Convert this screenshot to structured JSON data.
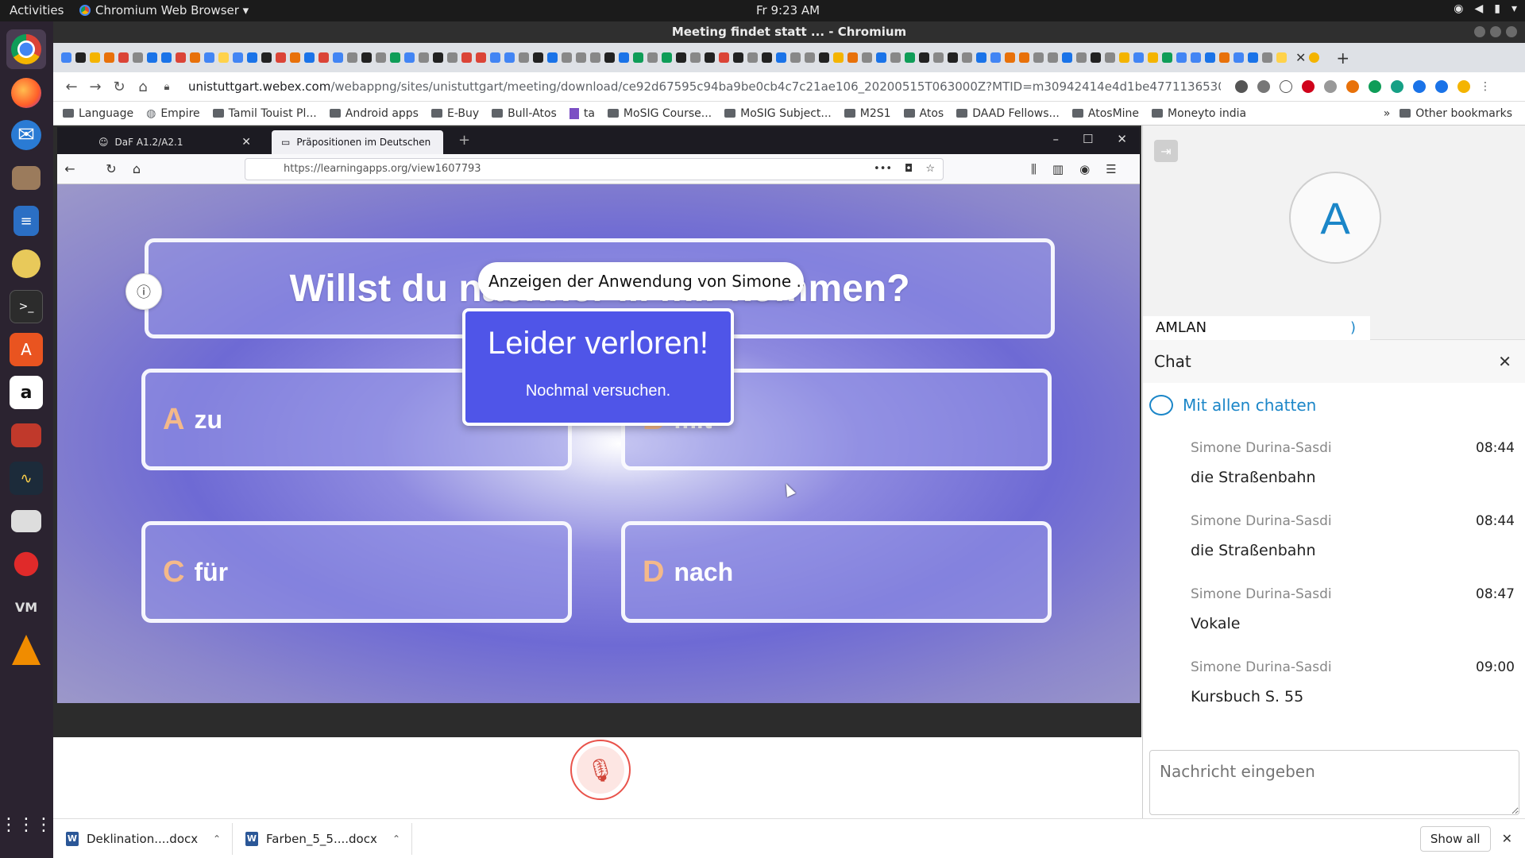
{
  "topbar": {
    "activities": "Activities",
    "app_menu": "Chromium Web Browser ▾",
    "clock": "Fr  9:23 AM"
  },
  "dock": {
    "items": [
      "chromium-icon",
      "firefox-icon",
      "thunderbird-icon",
      "files-icon",
      "writer-icon",
      "rhythmbox-icon",
      "terminal-icon",
      "software-icon",
      "amazon-icon",
      "presentation-icon",
      "monitor-icon",
      "camera-icon",
      "cherry-icon",
      "vm-icon",
      "vlc-icon",
      "apps-grid-icon"
    ]
  },
  "chromium": {
    "window_title": "Meeting findet statt ... - Chromium",
    "url_host": "unistuttgart.webex.com",
    "url_path": "/webappng/sites/unistuttgart/meeting/download/ce92d67595c94ba9be0cb4c7c21ae106_20200515T063000Z?MTID=m30942414e4d1be477113653036162165&launchApp...",
    "bookmarks": [
      "Language",
      "Empire",
      "Tamil Touist Pl...",
      "Android apps",
      "E-Buy",
      "Bull-Atos",
      "ta",
      "MoSIG Course...",
      "MoSIG Subject...",
      "M2S1",
      "Atos",
      "DAAD Fellows...",
      "AtosMine",
      "Moneyto india"
    ],
    "bookmarks_more": "»",
    "other_bookmarks": "Other bookmarks"
  },
  "shared_firefox": {
    "tab1_title": "DaF A1.2/A2.1",
    "tab2_title": "Präpositionen im Deutschen",
    "url": "https://learningapps.org/view1607793",
    "share_banner": "Anzeigen der Anwendung von Simone ..."
  },
  "game": {
    "question": "Willst du nachher ... mir kommen?",
    "answers": [
      {
        "letter": "A",
        "word": "zu"
      },
      {
        "letter": "B",
        "word": "mit"
      },
      {
        "letter": "C",
        "word": "für"
      },
      {
        "letter": "D",
        "word": "nach"
      }
    ],
    "popup_title": "Leider verloren!",
    "popup_subtitle": "Nochmal versuchen."
  },
  "participant": {
    "initial": "A",
    "name": "AMLAN"
  },
  "chat": {
    "title": "Chat",
    "target": "Mit allen chatten",
    "messages": [
      {
        "sender": "Simone Durina-Sasdi",
        "time": "08:44",
        "text": "die Straßenbahn"
      },
      {
        "sender": "Simone Durina-Sasdi",
        "time": "08:44",
        "text": "die Straßenbahn"
      },
      {
        "sender": "Simone Durina-Sasdi",
        "time": "08:47",
        "text": "Vokale"
      },
      {
        "sender": "Simone Durina-Sasdi",
        "time": "09:00",
        "text": "Kursbuch S. 55"
      }
    ],
    "input_placeholder": "Nachricht eingeben"
  },
  "downloads": {
    "files": [
      "Deklination....docx",
      "Farben_5_5....docx"
    ],
    "show_all": "Show all"
  },
  "colors": {
    "accent_blue": "#1b86c8",
    "mute_red": "#e9534b",
    "popup_blue": "#4f55e8",
    "answer_letter": "#f4b98a"
  }
}
